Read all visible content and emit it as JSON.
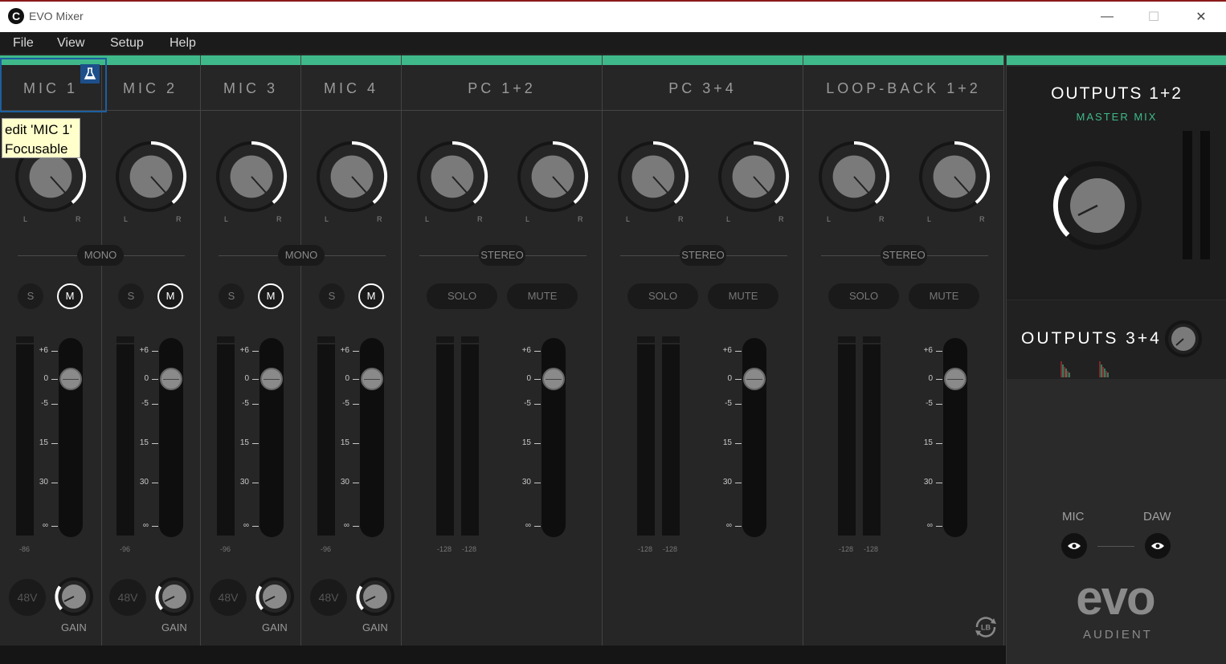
{
  "window": {
    "title": "EVO Mixer",
    "app_icon_letter": "C",
    "min_glyph": "—",
    "max_glyph": "☐",
    "close_glyph": "✕"
  },
  "menu": [
    "File",
    "View",
    "Setup",
    "Help"
  ],
  "scale_ticks": [
    "+6",
    "0",
    "-5",
    "15",
    "30",
    "∞"
  ],
  "mono_channels": [
    {
      "name": "MIC 1",
      "solo": "S",
      "mute": "M",
      "min": "-86",
      "phantom": "48V",
      "gain": "GAIN"
    },
    {
      "name": "MIC 2",
      "solo": "S",
      "mute": "M",
      "min": "-96",
      "phantom": "48V",
      "gain": "GAIN"
    },
    {
      "name": "MIC 3",
      "solo": "S",
      "mute": "M",
      "min": "-96",
      "phantom": "48V",
      "gain": "GAIN"
    },
    {
      "name": "MIC 4",
      "solo": "S",
      "mute": "M",
      "min": "-96",
      "phantom": "48V",
      "gain": "GAIN"
    }
  ],
  "stereo_channels": [
    {
      "name": "PC 1+2",
      "solo": "SOLO",
      "mute": "MUTE",
      "min_l": "-128",
      "min_r": "-128"
    },
    {
      "name": "PC 3+4",
      "solo": "SOLO",
      "mute": "MUTE",
      "min_l": "-128",
      "min_r": "-128"
    },
    {
      "name": "LOOP-BACK 1+2",
      "solo": "SOLO",
      "mute": "MUTE",
      "min_l": "-128",
      "min_r": "-128"
    }
  ],
  "pan_labels": {
    "left": "L",
    "right": "R"
  },
  "pairs": {
    "mono": "MONO",
    "stereo": "STEREO"
  },
  "outputs": {
    "main_title": "OUTPUTS 1+2",
    "main_subtitle": "MASTER MIX",
    "secondary_title": "OUTPUTS 3+4",
    "mic_label": "MIC",
    "daw_label": "DAW"
  },
  "brand": {
    "logo": "evo",
    "sub": "AUDIENT"
  },
  "tooltip": {
    "line1": "edit 'MIC 1'",
    "line2": "Focusable"
  },
  "colors": {
    "accent": "#3fb98a",
    "selection": "#1d5fa0",
    "tooltip_bg": "#ffffcc"
  }
}
